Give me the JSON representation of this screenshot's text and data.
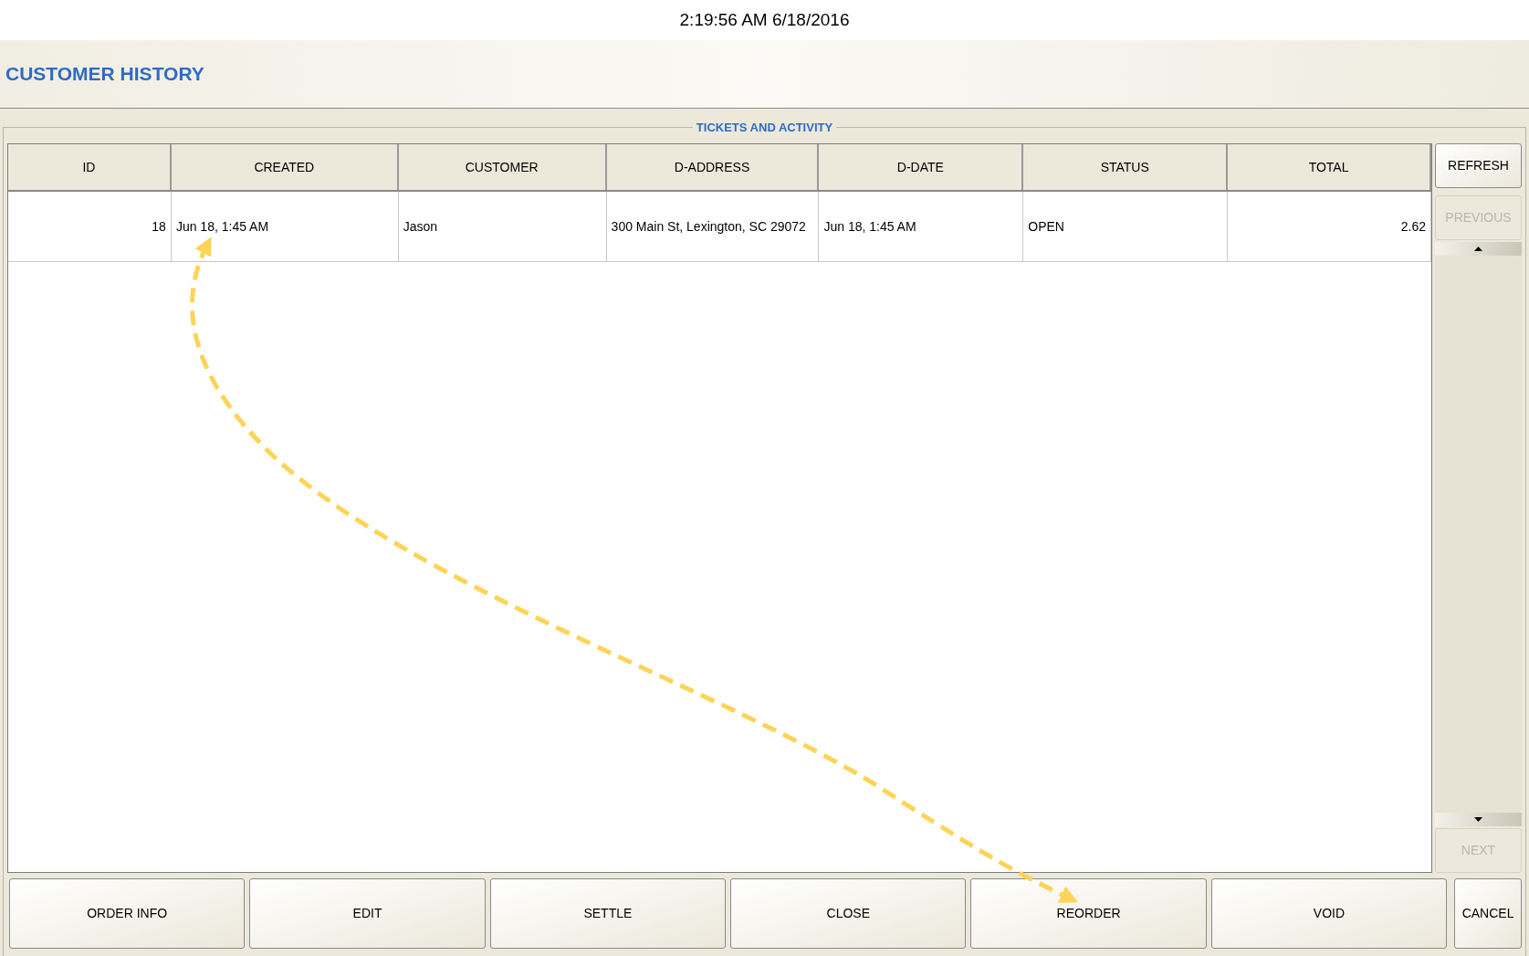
{
  "clock": "2:19:56 AM 6/18/2016",
  "header": {
    "title": "CUSTOMER HISTORY"
  },
  "group": {
    "legend": "TICKETS AND ACTIVITY"
  },
  "table": {
    "columns": [
      "ID",
      "CREATED",
      "CUSTOMER",
      "D-ADDRESS",
      "D-DATE",
      "STATUS",
      "TOTAL"
    ],
    "rows": [
      [
        "18",
        "Jun 18, 1:45 AM",
        "Jason",
        "300 Main St, Lexington, SC 29072",
        "Jun 18, 1:45 AM",
        "OPEN",
        "2.62"
      ]
    ]
  },
  "side_buttons": [
    {
      "label": "REFRESH",
      "disabled": false
    },
    {
      "label": "PREVIOUS",
      "disabled": true
    },
    {
      "label": "NEXT",
      "disabled": true
    }
  ],
  "bottom_buttons": [
    "ORDER INFO",
    "EDIT",
    "SETTLE",
    "CLOSE",
    "REORDER",
    "VOID"
  ],
  "cancel_button": "CANCEL"
}
